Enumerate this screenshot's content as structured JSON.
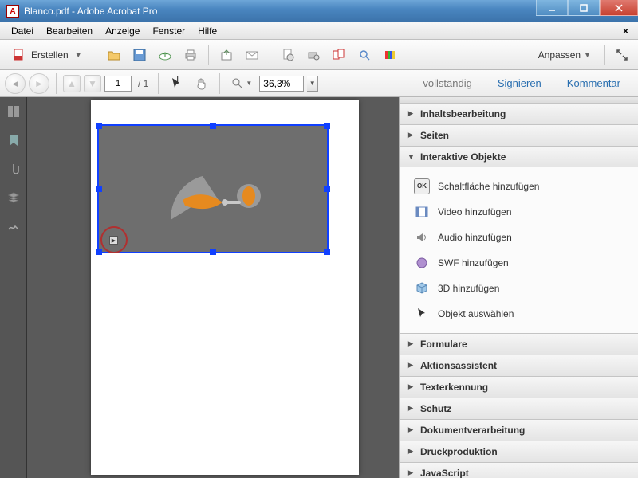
{
  "window": {
    "title": "Blanco.pdf - Adobe Acrobat Pro"
  },
  "menu": {
    "file": "Datei",
    "edit": "Bearbeiten",
    "view": "Anzeige",
    "window": "Fenster",
    "help": "Hilfe"
  },
  "toolbar": {
    "create": "Erstellen",
    "customize": "Anpassen"
  },
  "nav": {
    "page_current": "1",
    "page_total": "/ 1",
    "zoom": "36,3%"
  },
  "rightlinks": {
    "full": "vollständig",
    "sign": "Signieren",
    "comment": "Kommentar"
  },
  "panels": {
    "content_editing": "Inhaltsbearbeitung",
    "pages": "Seiten",
    "interactive": "Interaktive Objekte",
    "forms": "Formulare",
    "action_wizard": "Aktionsassistent",
    "ocr": "Texterkennung",
    "protection": "Schutz",
    "doc_processing": "Dokumentverarbeitung",
    "print_production": "Druckproduktion",
    "javascript": "JavaScript"
  },
  "tools": {
    "add_button": "Schaltfläche hinzufügen",
    "add_video": "Video hinzufügen",
    "add_audio": "Audio hinzufügen",
    "add_swf": "SWF hinzufügen",
    "add_3d": "3D hinzufügen",
    "select_object": "Objekt auswählen",
    "ok_badge": "OK"
  }
}
